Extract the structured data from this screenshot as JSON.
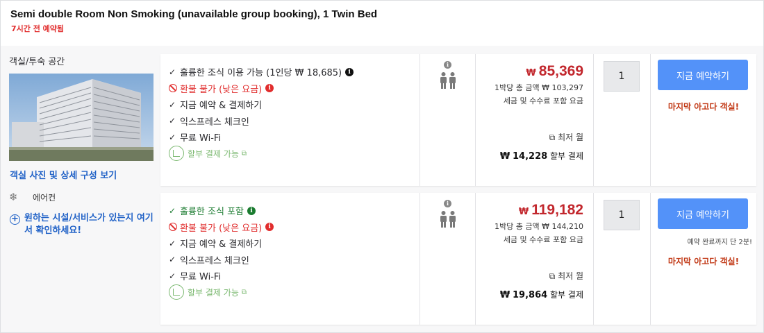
{
  "header": {
    "room_title": "Semi double Room Non Smoking (unavailable group booking), 1 Twin Bed",
    "booked_ago": "7시간 전 예약됨"
  },
  "left": {
    "room_type": "객실/투숙 공간",
    "details_link": "객실 사진 및 상세 구성 보기",
    "amenity": "에어컨",
    "request_link": "원하는 시설/서비스가 있는지 여기서 확인하세요!"
  },
  "offers": [
    {
      "benefits": {
        "breakfast": "훌륭한 조식 이용 가능 (1인당 ₩ 18,685)",
        "refund": "환불 불가 (낮은 요금)",
        "pay_now": "지금 예약 & 결제하기",
        "express": "익스프레스 체크인",
        "wifi": "무료 Wi-Fi",
        "installment": "할부 결제 가능"
      },
      "currency": "₩",
      "price": "85,369",
      "total_line": "1박당 총 금액 ₩ 103,297",
      "tax_line": "세금 및 수수료 포함 요금",
      "monthly_label": "최저 월",
      "monthly_currency": "₩",
      "monthly_amount": "14,228",
      "monthly_suffix": "할부 결제",
      "quantity": "1",
      "book_label": "지금 예약하기",
      "last_room": "마지막 아고다 객실!"
    },
    {
      "benefits": {
        "breakfast": "훌륭한 조식 포함",
        "refund": "환불 불가 (낮은 요금)",
        "pay_now": "지금 예약 & 결제하기",
        "express": "익스프레스 체크인",
        "wifi": "무료 Wi-Fi",
        "installment": "할부 결제 가능"
      },
      "currency": "₩",
      "price": "119,182",
      "total_line": "1박당 총 금액 ₩ 144,210",
      "tax_line": "세금 및 수수료 포함 요금",
      "monthly_label": "최저 월",
      "monthly_currency": "₩",
      "monthly_amount": "19,864",
      "monthly_suffix": "할부 결제",
      "quantity": "1",
      "book_label": "지금 예약하기",
      "done_note": "예약 완료까지 단 2분!",
      "last_room": "마지막 아고다 객실!"
    }
  ],
  "icons": {
    "check": "check-icon",
    "ban": "ban-icon",
    "info": "info-icon",
    "installment": "installment-leaf-icon",
    "external": "external-link-icon",
    "occupancy": "two-people-icon",
    "amenity": "snowflake-icon",
    "request": "plus-circle-icon"
  },
  "colors": {
    "price_red": "#c2272d",
    "accent_blue": "#5392f9",
    "link_blue": "#2162c7",
    "alert_red": "#e12d2d",
    "benefit_green": "#1a7b2f",
    "installment_green": "#7ab86f",
    "last_room_orange": "#c23a17"
  }
}
